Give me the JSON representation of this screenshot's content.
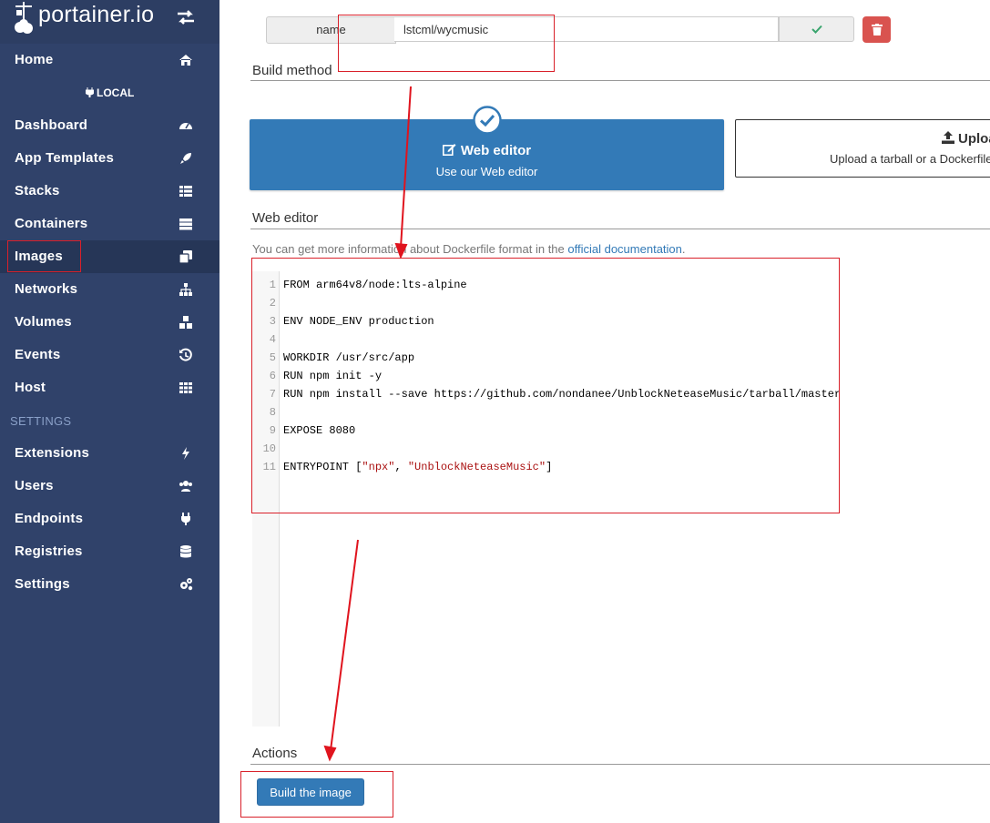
{
  "brand": {
    "logo_text": "portainer.io"
  },
  "sidebar": {
    "home": "Home",
    "endpoint": "LOCAL",
    "items": [
      {
        "label": "Dashboard",
        "icon": "tachometer-icon"
      },
      {
        "label": "App Templates",
        "icon": "rocket-icon"
      },
      {
        "label": "Stacks",
        "icon": "th-list-icon"
      },
      {
        "label": "Containers",
        "icon": "server-icon"
      },
      {
        "label": "Images",
        "icon": "clone-icon"
      },
      {
        "label": "Networks",
        "icon": "sitemap-icon"
      },
      {
        "label": "Volumes",
        "icon": "cubes-icon"
      },
      {
        "label": "Events",
        "icon": "history-icon"
      },
      {
        "label": "Host",
        "icon": "th-icon"
      }
    ],
    "settings_heading": "SETTINGS",
    "settings_items": [
      {
        "label": "Extensions",
        "icon": "bolt-icon"
      },
      {
        "label": "Users",
        "icon": "users-icon"
      },
      {
        "label": "Endpoints",
        "icon": "plug-icon"
      },
      {
        "label": "Registries",
        "icon": "database-icon"
      },
      {
        "label": "Settings",
        "icon": "cogs-icon"
      }
    ]
  },
  "form": {
    "name_label": "name",
    "name_value": "lstcml/wycmusic"
  },
  "build_method": {
    "title": "Build method",
    "web_editor_title": "Web editor",
    "web_editor_desc": "Use our Web editor",
    "upload_title": "Upload",
    "upload_desc": "Upload a tarball or a Dockerfile"
  },
  "web_editor": {
    "title": "Web editor",
    "hint_prefix": "You can get more information about Dockerfile format in the ",
    "hint_link": "official documentation",
    "hint_suffix": ".",
    "lines": [
      {
        "num": "1",
        "code": "FROM arm64v8/node:lts-alpine"
      },
      {
        "num": "2",
        "code": ""
      },
      {
        "num": "3",
        "code": "ENV NODE_ENV production"
      },
      {
        "num": "4",
        "code": ""
      },
      {
        "num": "5",
        "code": "WORKDIR /usr/src/app"
      },
      {
        "num": "6",
        "code": "RUN npm init -y"
      },
      {
        "num": "7",
        "code": "RUN npm install --save https://github.com/nondanee/UnblockNeteaseMusic/tarball/master"
      },
      {
        "num": "8",
        "code": ""
      },
      {
        "num": "9",
        "code": "EXPOSE 8080"
      },
      {
        "num": "10",
        "code": ""
      },
      {
        "num": "11",
        "code": "ENTRYPOINT [",
        "strings": [
          "\"npx\"",
          "\"UnblockNeteaseMusic\""
        ],
        "tail": "]"
      }
    ]
  },
  "actions": {
    "title": "Actions",
    "build_button": "Build the image"
  },
  "colors": {
    "sidebar": "#30426a",
    "primary": "#337ab7",
    "danger": "#d9534f",
    "annotation": "#e0141e"
  }
}
